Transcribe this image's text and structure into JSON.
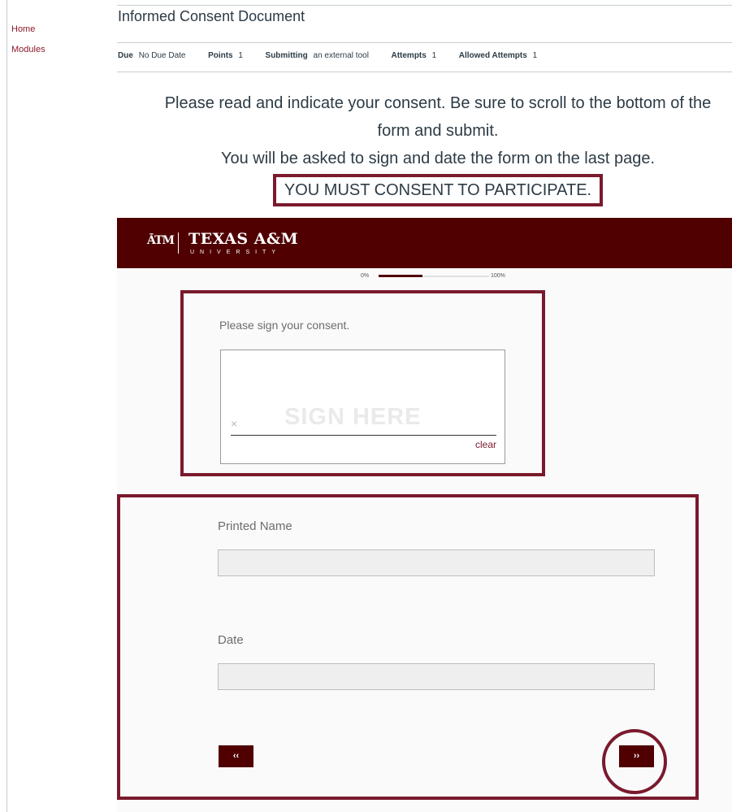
{
  "nav": {
    "home": "Home",
    "modules": "Modules"
  },
  "assignment": {
    "title": "Informed Consent Document",
    "due_label": "Due",
    "due_value": "No Due Date",
    "points_label": "Points",
    "points_value": "1",
    "submitting_label": "Submitting",
    "submitting_value": "an external tool",
    "attempts_label": "Attempts",
    "attempts_value": "1",
    "allowed_label": "Allowed Attempts",
    "allowed_value": "1"
  },
  "instructions": {
    "line1": "Please read and indicate your consent. Be sure to scroll to the bottom of the",
    "line2": "form and submit.",
    "line3": "You will be asked to sign and date the form on the last page.",
    "line4": "YOU MUST CONSENT TO PARTICIPATE."
  },
  "banner": {
    "logo_mark": "ĀTM",
    "logo_text": "TEXAS A&M",
    "logo_sub": "UNIVERSITY",
    "color": "#500000"
  },
  "progress": {
    "start_label": "0%",
    "end_label": "100%",
    "value": 0.4
  },
  "signature": {
    "label": "Please sign your consent.",
    "watermark": "SIGN HERE",
    "x_mark": "×",
    "clear": "clear"
  },
  "form": {
    "printed_name_label": "Printed Name",
    "printed_name_value": "",
    "date_label": "Date",
    "date_value": "",
    "prev_button": "‹‹",
    "next_button": "››"
  },
  "colors": {
    "accent": "#7a1a2d",
    "maroon": "#500000"
  }
}
